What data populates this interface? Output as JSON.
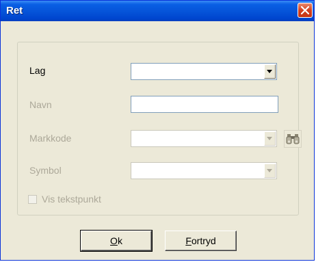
{
  "window": {
    "title": "Ret"
  },
  "form": {
    "lag_label": "Lag",
    "lag_value": "",
    "navn_label": "Navn",
    "navn_value": "",
    "markkode_label": "Markkode",
    "markkode_value": "",
    "symbol_label": "Symbol",
    "symbol_value": "",
    "vis_tekstpunkt_label": "Vis tekstpunkt",
    "vis_tekstpunkt_checked": false
  },
  "buttons": {
    "ok_mnemonic": "O",
    "ok_rest": "k",
    "cancel_mnemonic": "F",
    "cancel_rest": "ortryd"
  },
  "icons": {
    "close": "close-icon",
    "find": "binoculars-icon",
    "dropdown": "chevron-down-icon"
  },
  "colors": {
    "titlebar": "#0553d8",
    "close_button": "#d4401f",
    "dialog_bg": "#ece9d8",
    "disabled_text": "#aca899"
  }
}
